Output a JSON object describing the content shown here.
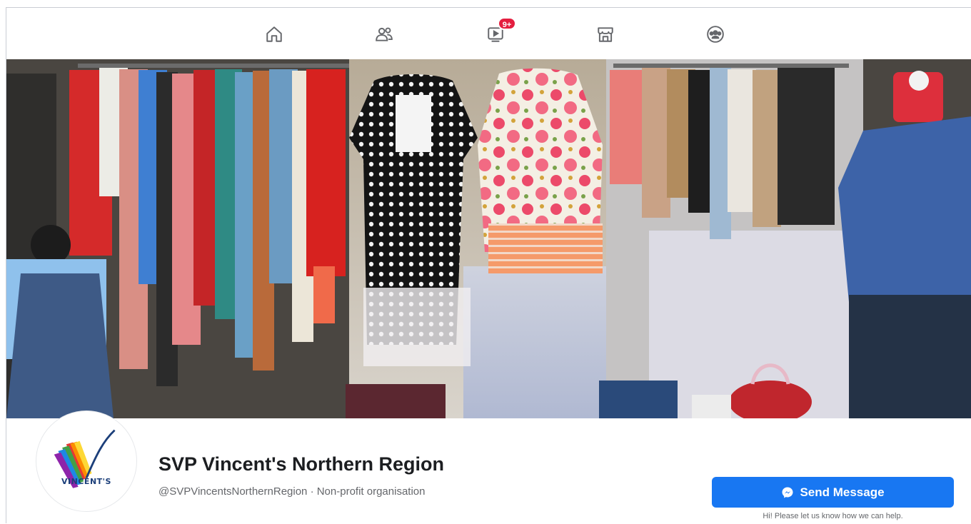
{
  "nav": {
    "tabs": [
      {
        "name": "home",
        "icon": "home-icon"
      },
      {
        "name": "friends",
        "icon": "friends-icon"
      },
      {
        "name": "watch",
        "icon": "video-icon",
        "badge": "9+"
      },
      {
        "name": "marketplace",
        "icon": "marketplace-icon"
      },
      {
        "name": "groups",
        "icon": "groups-icon"
      }
    ],
    "badge_color": "#e41e3f"
  },
  "page": {
    "title": "SVP Vincent's Northern Region",
    "subtitle": "@SVPVincentsNorthernRegion · Non-profit organisation",
    "logo_text": "VINCENT'S"
  },
  "actions": {
    "send_message_label": "Send Message",
    "help_text": "Hi! Please let us know how we can help.",
    "accent": "#1877f2"
  }
}
